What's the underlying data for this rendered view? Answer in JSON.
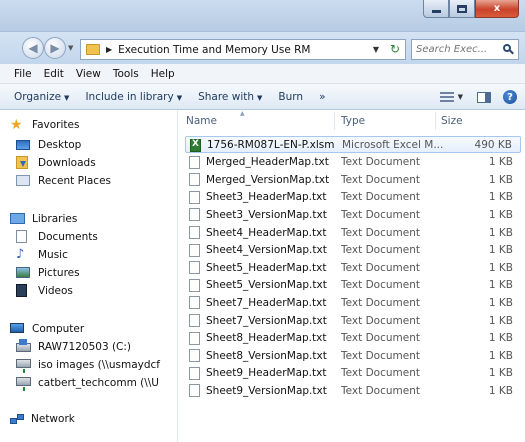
{
  "window": {
    "minimize": "",
    "maximize": "",
    "close": "x"
  },
  "address": {
    "path": "Execution Time and Memory Use RM",
    "search_placeholder": "Search Exec..."
  },
  "menu": [
    "File",
    "Edit",
    "View",
    "Tools",
    "Help"
  ],
  "toolbar": {
    "organize": "Organize",
    "include": "Include in library",
    "share": "Share with",
    "burn": "Burn",
    "more": "»"
  },
  "nav": {
    "favorites": "Favorites",
    "desktop": "Desktop",
    "downloads": "Downloads",
    "recent": "Recent Places",
    "libraries": "Libraries",
    "documents": "Documents",
    "music": "Music",
    "pictures": "Pictures",
    "videos": "Videos",
    "computer": "Computer",
    "drive_c": "RAW7120503 (C:)",
    "iso": "iso images (\\\\usmaydcf",
    "catbert": "catbert_techcomm (\\\\U",
    "network": "Network"
  },
  "columns": {
    "name": "Name",
    "type": "Type",
    "size": "Size"
  },
  "files": [
    {
      "name": "1756-RM087L-EN-P.xlsm",
      "type": "Microsoft Excel M...",
      "size": "490 KB"
    },
    {
      "name": "Merged_HeaderMap.txt",
      "type": "Text Document",
      "size": "1 KB"
    },
    {
      "name": "Merged_VersionMap.txt",
      "type": "Text Document",
      "size": "1 KB"
    },
    {
      "name": "Sheet3_HeaderMap.txt",
      "type": "Text Document",
      "size": "1 KB"
    },
    {
      "name": "Sheet3_VersionMap.txt",
      "type": "Text Document",
      "size": "1 KB"
    },
    {
      "name": "Sheet4_HeaderMap.txt",
      "type": "Text Document",
      "size": "1 KB"
    },
    {
      "name": "Sheet4_VersionMap.txt",
      "type": "Text Document",
      "size": "1 KB"
    },
    {
      "name": "Sheet5_HeaderMap.txt",
      "type": "Text Document",
      "size": "1 KB"
    },
    {
      "name": "Sheet5_VersionMap.txt",
      "type": "Text Document",
      "size": "1 KB"
    },
    {
      "name": "Sheet7_HeaderMap.txt",
      "type": "Text Document",
      "size": "1 KB"
    },
    {
      "name": "Sheet7_VersionMap.txt",
      "type": "Text Document",
      "size": "1 KB"
    },
    {
      "name": "Sheet8_HeaderMap.txt",
      "type": "Text Document",
      "size": "1 KB"
    },
    {
      "name": "Sheet8_VersionMap.txt",
      "type": "Text Document",
      "size": "1 KB"
    },
    {
      "name": "Sheet9_HeaderMap.txt",
      "type": "Text Document",
      "size": "1 KB"
    },
    {
      "name": "Sheet9_VersionMap.txt",
      "type": "Text Document",
      "size": "1 KB"
    }
  ],
  "colors": {
    "selected_row_border": "#a7c8ee",
    "toolbar_text": "#1e395b",
    "close_button": "#c9432a"
  }
}
